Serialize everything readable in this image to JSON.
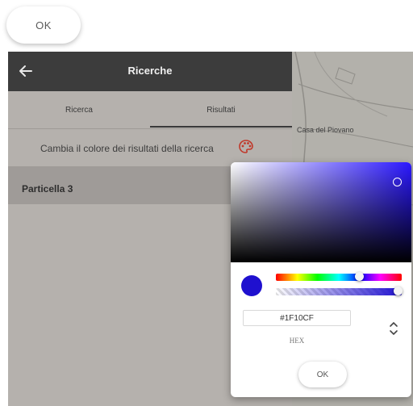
{
  "top_button": {
    "label": "OK"
  },
  "app": {
    "title": "Ricerche",
    "back_icon": "arrow-left-icon",
    "tabs": [
      {
        "label": "Ricerca"
      },
      {
        "label": "Risultati"
      }
    ],
    "active_tab": "Risultati"
  },
  "results": {
    "change_color_text": "Cambia il colore dei risultati della ricerca",
    "palette_icon": "palette-icon",
    "items": [
      {
        "label": "Particella 3"
      }
    ]
  },
  "map": {
    "place_label": "Casa del Piovano"
  },
  "color_picker": {
    "selected_color": "#1F10CF",
    "hex_value": "#1F10CF",
    "mode_label": "HEX",
    "ok_label": "OK",
    "mode_toggle_icon": "chevron-up-down-icon"
  },
  "colors": {
    "appbar": "#3c3c3c",
    "panel": "#b5b1ad",
    "result_row": "#9f9b98",
    "palette_icon": "#c0392b"
  }
}
